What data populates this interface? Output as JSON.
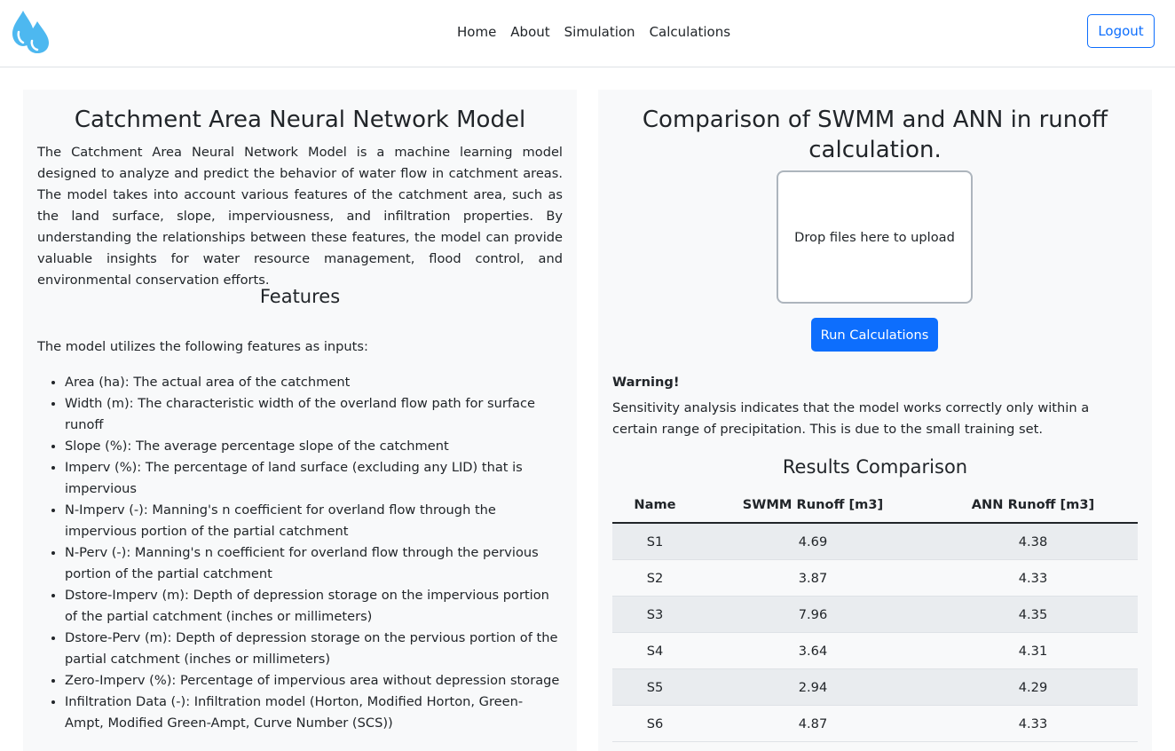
{
  "nav": {
    "logo_icon": "water-drops-icon",
    "links": [
      {
        "label": "Home"
      },
      {
        "label": "About"
      },
      {
        "label": "Simulation"
      },
      {
        "label": "Calculations"
      }
    ],
    "logout_label": "Logout"
  },
  "left": {
    "title": "Catchment Area Neural Network Model",
    "intro": "The Catchment Area Neural Network Model is a machine learning model designed to analyze and predict the behavior of water flow in catchment areas. The model takes into account various features of the catchment area, such as the land surface, slope, imperviousness, and infiltration properties. By understanding the relationships between these features, the model can provide valuable insights for water resource management, flood control, and environmental conservation efforts.",
    "features_title": "Features",
    "features_lead": "The model utilizes the following features as inputs:",
    "features": [
      "Area (ha): The actual area of the catchment",
      "Width (m): The characteristic width of the overland flow path for surface runoff",
      "Slope (%): The average percentage slope of the catchment",
      "Imperv (%): The percentage of land surface (excluding any LID) that is impervious",
      "N-Imperv (-): Manning's n coefficient for overland flow through the impervious portion of the partial catchment",
      "N-Perv (-): Manning's n coefficient for overland flow through the pervious portion of the partial catchment",
      "Dstore-Imperv (m): Depth of depression storage on the impervious portion of the partial catchment (inches or millimeters)",
      "Dstore-Perv (m): Depth of depression storage on the pervious portion of the partial catchment (inches or millimeters)",
      "Zero-Imperv (%): Percentage of impervious area without depression storage",
      "Infiltration Data (-): Infiltration model (Horton, Modified Horton, Green-Ampt, Modified Green-Ampt, Curve Number (SCS))"
    ]
  },
  "right": {
    "title": "Comparison of SWMM and ANN in runoff calculation.",
    "dropzone_text": "Drop files here to upload",
    "run_button": "Run Calculations",
    "warning_title": "Warning!",
    "warning_text": "Sensitivity analysis indicates that the model works correctly only within a certain range of precipitation. This is due to the small training set.",
    "results_title": "Results Comparison",
    "table": {
      "headers": [
        "Name",
        "SWMM Runoff [m3]",
        "ANN Runoff [m3]"
      ],
      "rows": [
        [
          "S1",
          "4.69",
          "4.38"
        ],
        [
          "S2",
          "3.87",
          "4.33"
        ],
        [
          "S3",
          "7.96",
          "4.35"
        ],
        [
          "S4",
          "3.64",
          "4.31"
        ],
        [
          "S5",
          "2.94",
          "4.29"
        ],
        [
          "S6",
          "4.87",
          "4.33"
        ]
      ]
    }
  },
  "colors": {
    "primary": "#0d6efd",
    "panel_bg": "#f8f9fa",
    "stripe_bg": "#e9ecef",
    "logo_blue": "#4db8f0"
  }
}
